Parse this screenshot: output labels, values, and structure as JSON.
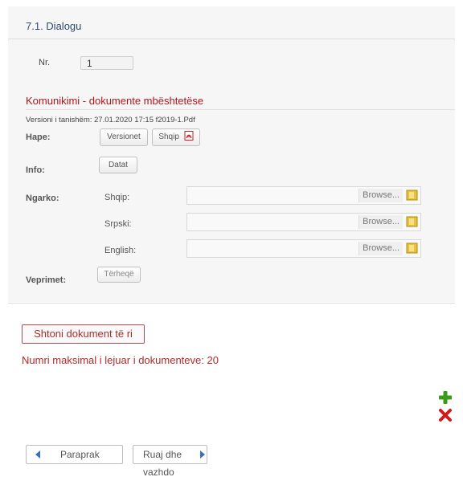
{
  "panel": {
    "title": "7.1. Dialogu",
    "nr_label": "Nr.",
    "nr_value": "1"
  },
  "documents": {
    "section_title": "Komunikimi - dokumente mbështetëse",
    "version_text": "Versioni i tanishëm: 27.01.2020 17:15   f2019-1.Pdf",
    "open_label": "Hape:",
    "versions_button": "Versionet",
    "shqip_button": "Shqip",
    "info_label": "Info:",
    "dates_button": "Datat",
    "upload_label": "Ngarko:",
    "uploads": [
      {
        "language": "Shqip:",
        "value": "",
        "browse": "Browse..."
      },
      {
        "language": "Srpski:",
        "value": "",
        "browse": "Browse..."
      },
      {
        "language": "English:",
        "value": "",
        "browse": "Browse..."
      }
    ],
    "actions_label": "Veprimet:",
    "withdraw_button": "Tërheqë"
  },
  "footer": {
    "add_document_button": "Shtoni dokument të ri",
    "max_documents_text": "Numri maksimal i lejuar i dokumenteve: 20",
    "prev_button": "Paraprak",
    "save_continue_button": "Ruaj dhe vazhdo"
  },
  "colors": {
    "accent_red": "#b02a2a",
    "title_blue": "#2b4a72",
    "add_green": "#3a9a1a",
    "delete_red": "#d11a1a",
    "nav_blue": "#3a6fc2"
  },
  "icons": {
    "pdf": "pdf-icon",
    "folder": "folder-icon",
    "add": "plus-icon",
    "delete": "x-icon",
    "prev": "arrow-left-icon",
    "next": "arrow-right-icon"
  }
}
